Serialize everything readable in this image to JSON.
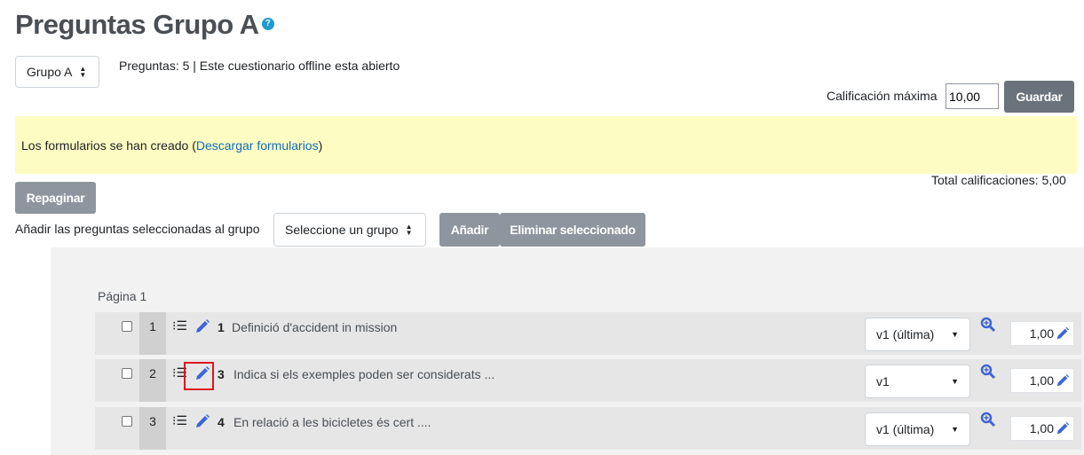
{
  "header": {
    "title": "Preguntas Grupo A",
    "help_icon": "question-circle-icon"
  },
  "group_select": {
    "value": "Grupo A"
  },
  "info_text": "Preguntas: 5 | Este cuestionario offline esta abierto",
  "grade": {
    "label": "Calificación máxima",
    "value": "10,00",
    "save_label": "Guardar"
  },
  "alert": {
    "text_before": "Los formularios se han creado (",
    "link": "Descargar formularios",
    "text_after": ")",
    "color": "#fdfcc2"
  },
  "total_label": "Total calificaciones: 5,00",
  "repaginate_label": "Repaginar",
  "add_to_group": {
    "label": "Añadir las preguntas seleccionadas al grupo",
    "select_value": "Seleccione un grupo",
    "add_label": "Añadir",
    "remove_label": "Eliminar seleccionado"
  },
  "page_label": "Página 1",
  "questions": [
    {
      "slot": "1",
      "number": "1",
      "name": "Definició d'accident in mission",
      "version": "v1 (última)",
      "mark": "1,00"
    },
    {
      "slot": "2",
      "number": "3",
      "name": "Indica si els exemples poden ser considerats ...",
      "version": "v1",
      "mark": "1,00"
    },
    {
      "slot": "3",
      "number": "4",
      "name": "En relació a les bicicletes és cert ....",
      "version": "v1 (última)",
      "mark": "1,00"
    }
  ],
  "colors": {
    "accent": "#0f6cbf",
    "icon_blue": "#3e65d6",
    "button_gray": "#8f959e",
    "highlight": "#e0121e"
  }
}
